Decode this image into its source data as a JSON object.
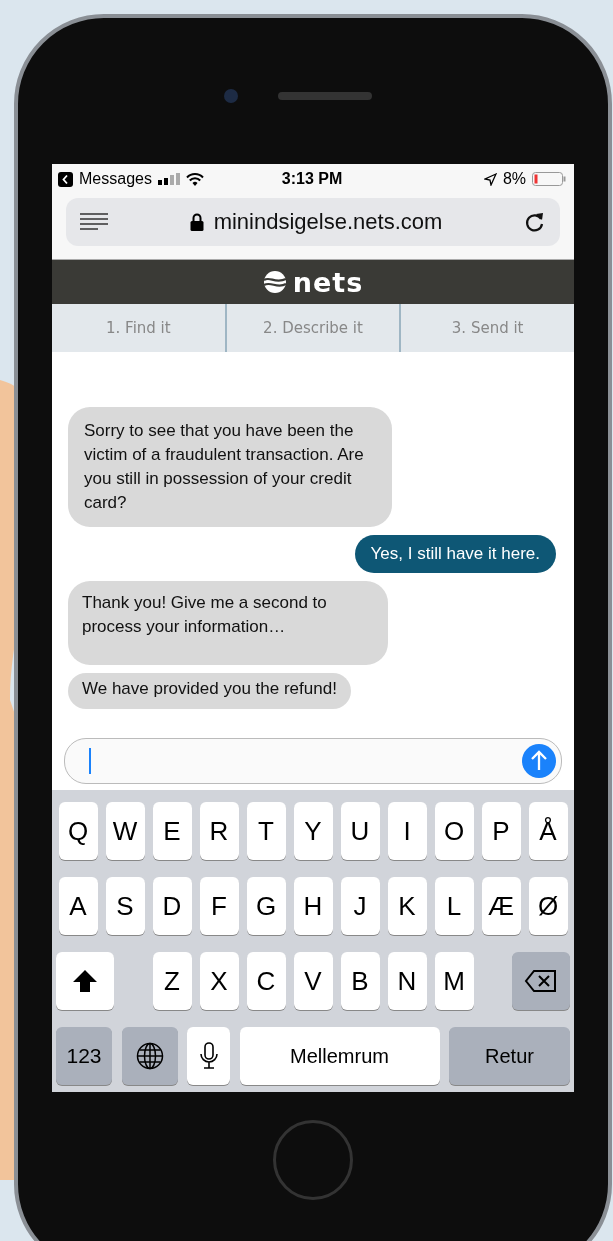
{
  "status_bar": {
    "back_app": "Messages",
    "time": "3:13 PM",
    "battery": "8%"
  },
  "browser": {
    "url": "minindsigelse.nets.com"
  },
  "header": {
    "logo": "nets"
  },
  "steps": [
    "1. Find it",
    "2. Describe it",
    "3. Send it"
  ],
  "messages": [
    {
      "kind": "bot",
      "text": "Sorry to see that you have been the victim of a fraudulent transaction. Are you still in possession of your credit card?"
    },
    {
      "kind": "user",
      "text": "Yes, I still have it here."
    },
    {
      "kind": "bot",
      "text": "Thank you! Give me a second to process your information…"
    },
    {
      "kind": "bot",
      "text": "We have provided you the refund!"
    }
  ],
  "keyboard": {
    "top_row": [
      "Q",
      "W",
      "E",
      "R",
      "T",
      "Y",
      "U",
      "I",
      "O",
      "P",
      "Å"
    ],
    "home_row": [
      "A",
      "S",
      "D",
      "F",
      "G",
      "H",
      "J",
      "K",
      "L",
      "Æ",
      "Ø"
    ],
    "bottom_row": [
      "Z",
      "X",
      "C",
      "V",
      "B",
      "N",
      "M"
    ],
    "numbers_key": "123",
    "space_key": "Mellemrum",
    "return_key": "Retur"
  }
}
